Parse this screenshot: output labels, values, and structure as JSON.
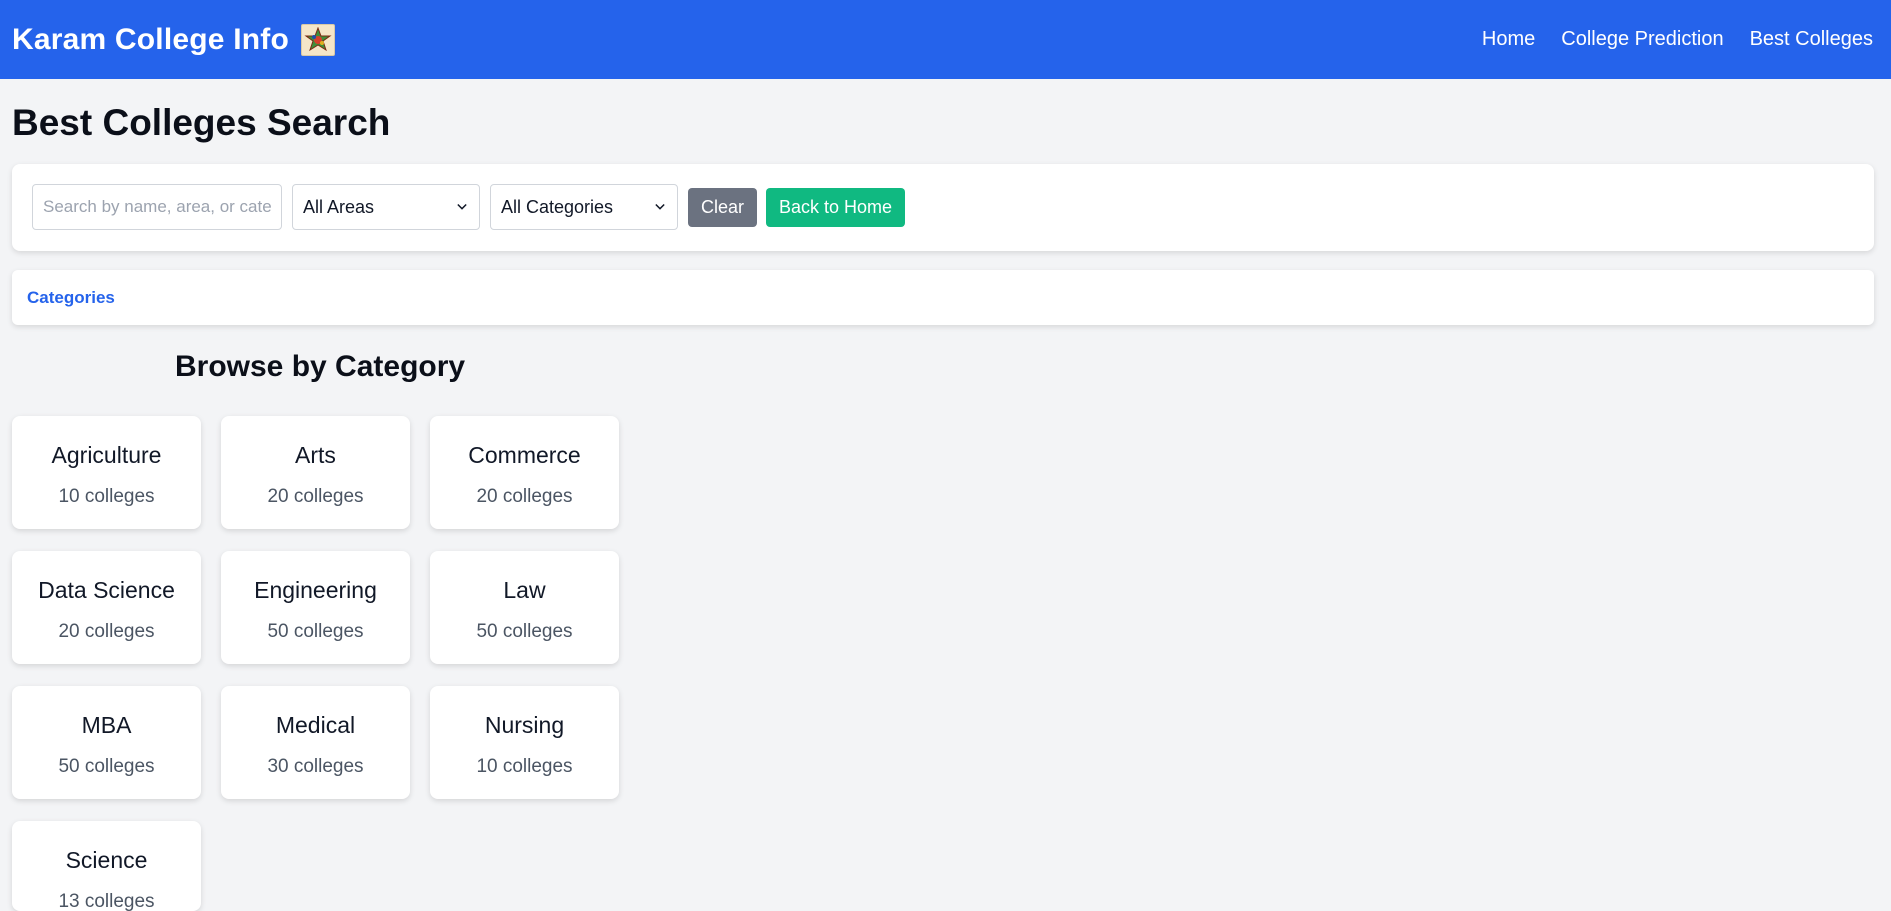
{
  "navbar": {
    "brand": "Karam College Info",
    "links": [
      "Home",
      "College Prediction",
      "Best Colleges"
    ]
  },
  "page_title": "Best Colleges Search",
  "search": {
    "placeholder": "Search by name, area, or category",
    "value": "",
    "area_select": "All Areas",
    "category_select": "All Categories",
    "clear_label": "Clear",
    "back_label": "Back to Home"
  },
  "tabs": {
    "categories": "Categories"
  },
  "section_title": "Browse by Category",
  "categories": [
    {
      "name": "Agriculture",
      "count": "10 colleges"
    },
    {
      "name": "Arts",
      "count": "20 colleges"
    },
    {
      "name": "Commerce",
      "count": "20 colleges"
    },
    {
      "name": "Data Science",
      "count": "20 colleges"
    },
    {
      "name": "Engineering",
      "count": "50 colleges"
    },
    {
      "name": "Law",
      "count": "50 colleges"
    },
    {
      "name": "MBA",
      "count": "50 colleges"
    },
    {
      "name": "Medical",
      "count": "30 colleges"
    },
    {
      "name": "Nursing",
      "count": "10 colleges"
    },
    {
      "name": "Science",
      "count": "13 colleges"
    }
  ],
  "colors": {
    "navbar": "#2563eb",
    "clear_button": "#6b7280",
    "home_button": "#10b981",
    "tab_active": "#2563eb"
  }
}
